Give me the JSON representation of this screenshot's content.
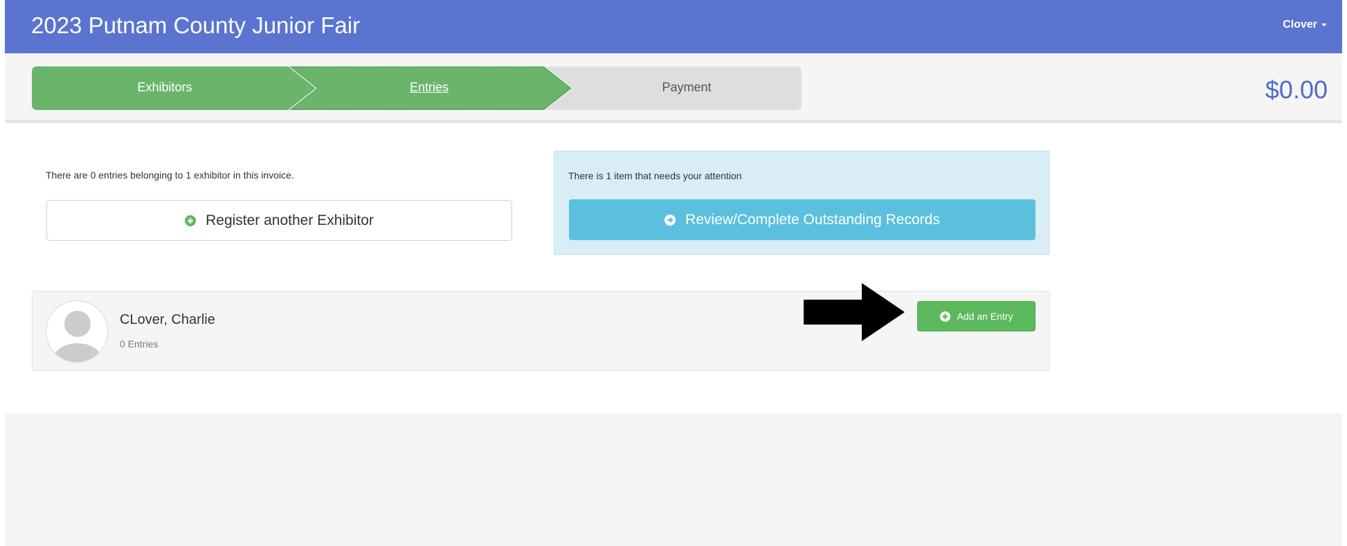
{
  "header": {
    "title": "2023 Putnam County Junior Fair",
    "user": "Clover"
  },
  "steps": [
    {
      "label": "Exhibitors",
      "state": "complete"
    },
    {
      "label": "Entries",
      "state": "active"
    },
    {
      "label": "Payment",
      "state": "pending"
    }
  ],
  "total": "$0.00",
  "summary": {
    "entries_text": "There are 0 entries belonging to 1 exhibitor in this invoice.",
    "register_button": "Register another Exhibitor"
  },
  "attention": {
    "text": "There is 1 item that needs your attention",
    "review_button": "Review/Complete Outstanding Records"
  },
  "exhibitor": {
    "name": "CLover, Charlie",
    "entries": "0 Entries",
    "add_button": "Add an Entry"
  },
  "colors": {
    "header": "#5a74d0",
    "step_green": "#6ab46b",
    "info": "#5bc0de",
    "success": "#5cb85c"
  }
}
